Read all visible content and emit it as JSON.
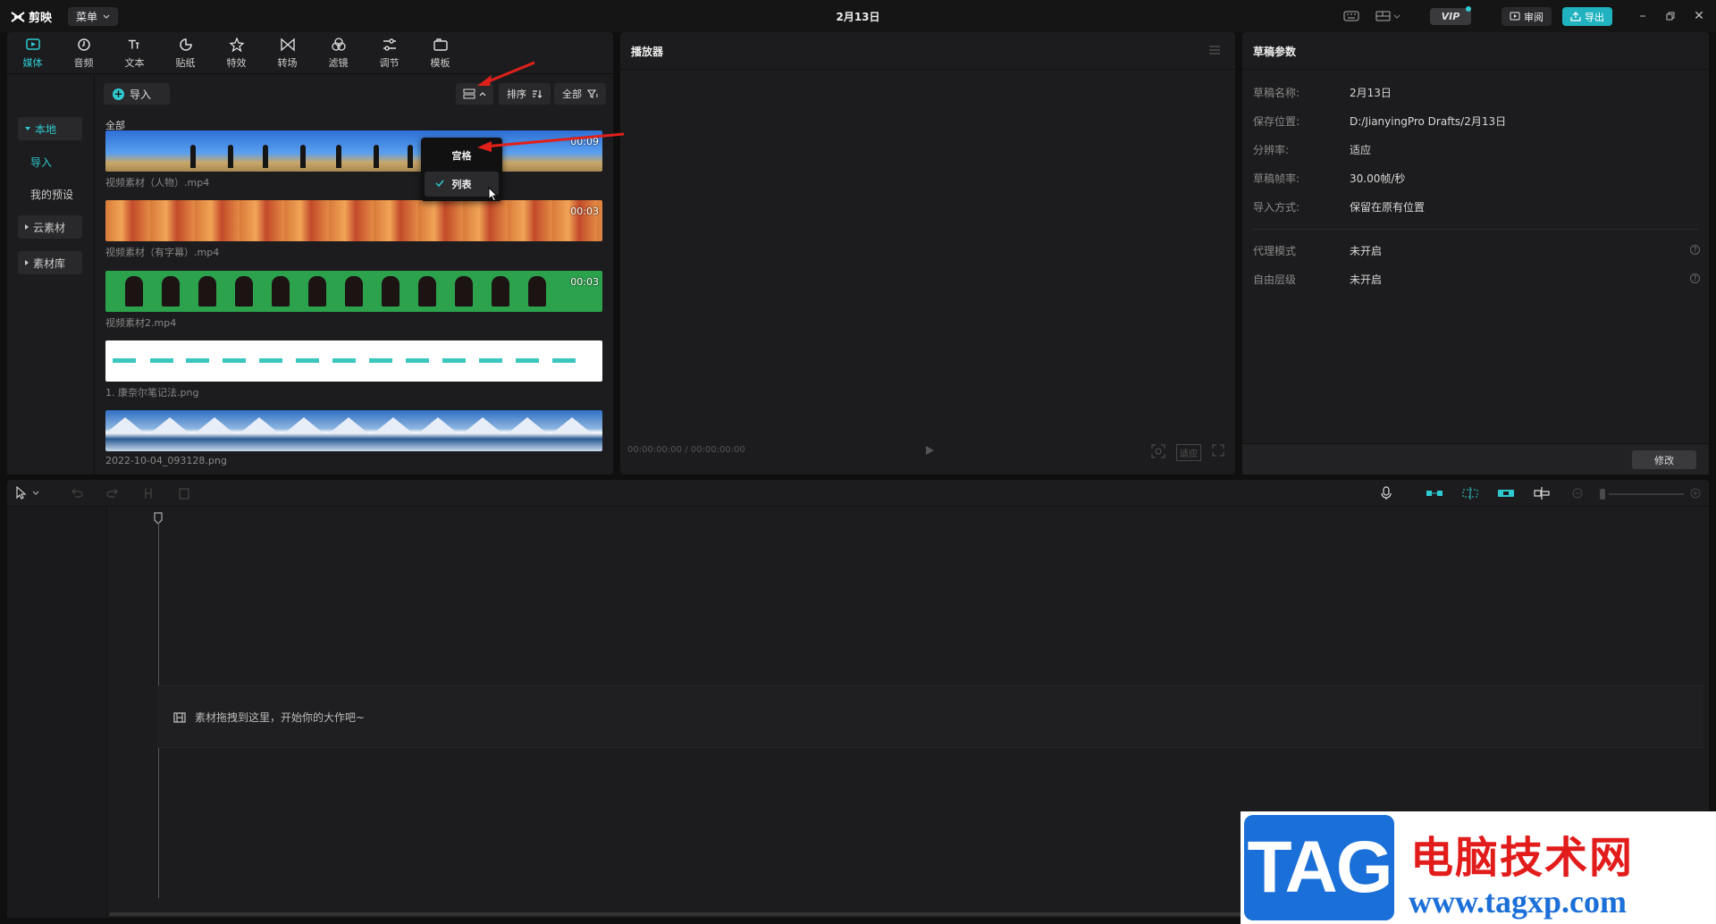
{
  "app": {
    "name": "剪映",
    "menu_label": "菜单",
    "project_title": "2月13日",
    "vip_label": "VIP",
    "review_label": "审阅",
    "export_label": "导出"
  },
  "media_tabs": [
    {
      "label": "媒体",
      "icon": "media-icon",
      "active": true
    },
    {
      "label": "音频",
      "icon": "audio-icon"
    },
    {
      "label": "文本",
      "icon": "text-icon"
    },
    {
      "label": "贴纸",
      "icon": "sticker-icon"
    },
    {
      "label": "特效",
      "icon": "effects-icon"
    },
    {
      "label": "转场",
      "icon": "transition-icon"
    },
    {
      "label": "滤镜",
      "icon": "filter-icon"
    },
    {
      "label": "调节",
      "icon": "adjust-icon"
    },
    {
      "label": "模板",
      "icon": "template-icon"
    }
  ],
  "sidebar": {
    "local": "本地",
    "import": "导入",
    "presets": "我的预设",
    "cloud": "云素材",
    "library": "素材库"
  },
  "toolbar": {
    "import_label": "导入",
    "sort_label": "排序",
    "filter_label": "全部",
    "all_label": "全部"
  },
  "view_menu": {
    "grid": "宫格",
    "list": "列表",
    "selected": "列表"
  },
  "media_items": [
    {
      "name": "视频素材（人物）.mp4",
      "duration": "00:09"
    },
    {
      "name": "视频素材（有字幕）.mp4",
      "duration": "00:03"
    },
    {
      "name": "视频素材2.mp4",
      "duration": "00:03"
    },
    {
      "name": "1. 康奈尔笔记法.png",
      "duration": ""
    },
    {
      "name": "2022-10-04_093128.png",
      "duration": ""
    }
  ],
  "player": {
    "title": "播放器",
    "time_current": "00:00:00:00",
    "time_total": "00:00:00:00",
    "ratio_label": "适应"
  },
  "draft": {
    "title": "草稿参数",
    "name_label": "草稿名称:",
    "name_value": "2月13日",
    "path_label": "保存位置:",
    "path_value": "D:/JianyingPro Drafts/2月13日",
    "resolution_label": "分辨率:",
    "resolution_value": "适应",
    "fps_label": "草稿帧率:",
    "fps_value": "30.00帧/秒",
    "import_label": "导入方式:",
    "import_value": "保留在原有位置",
    "proxy_label": "代理模式",
    "proxy_value": "未开启",
    "layer_label": "自由层级",
    "layer_value": "未开启",
    "modify_label": "修改"
  },
  "timeline": {
    "drop_hint": "素材拖拽到这里，开始你的大作吧~"
  },
  "watermark": {
    "tag": "TAG",
    "site_cn": "电脑技术网",
    "url": "www.tagxp.com"
  },
  "colors": {
    "accent": "#2ecad0",
    "panel": "#1c1c1e",
    "background": "#0f0f10",
    "arrow": "#e0201a"
  }
}
